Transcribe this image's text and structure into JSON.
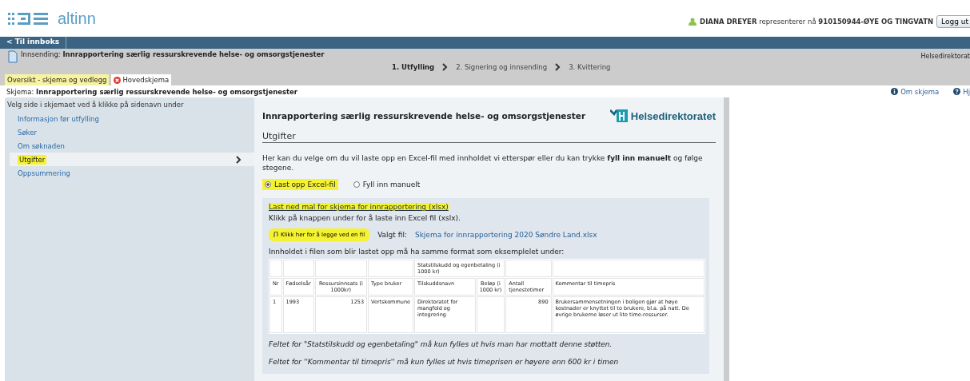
{
  "header": {
    "logo": "altinn",
    "user": "DIANA DREYER",
    "represents_label": "representerer nå",
    "org": "910150944-ØYE OG TINGVATN",
    "logout": "Logg ut"
  },
  "nav_bar": {
    "back": "< Til innboks"
  },
  "submission": {
    "label": "Innsending:",
    "title": "Innrapportering særlig ressurskrevende helse- og omsorgstjenester",
    "agency": "Helsedirektorat",
    "steps": [
      {
        "label": "1. Utfylling",
        "selected": true
      },
      {
        "label": "2. Signering og innsending",
        "selected": false
      },
      {
        "label": "3. Kvittering",
        "selected": false
      }
    ]
  },
  "tabs": [
    {
      "label": "Oversikt - skjema og vedlegg",
      "selected": false,
      "error": false
    },
    {
      "label": "Hovedskjema",
      "selected": true,
      "error": true
    }
  ],
  "form_line": {
    "label": "Skjema:",
    "title": "Innrapportering særlig ressurskrevende helse- og omsorgstjenester",
    "links": [
      "Om skjema",
      "Hj"
    ]
  },
  "sidebar": {
    "heading": "Velg side i skjemaet ved å klikke på sidenavn under",
    "items": [
      {
        "label": "Informasjon før utfylling",
        "selected": false,
        "highlighted": false
      },
      {
        "label": "Søker",
        "selected": false,
        "highlighted": false
      },
      {
        "label": "Om søknaden",
        "selected": false,
        "highlighted": false
      },
      {
        "label": "Utgifter",
        "selected": true,
        "highlighted": true
      },
      {
        "label": "Oppsummering",
        "selected": false,
        "highlighted": false
      }
    ]
  },
  "main": {
    "title": "Innrapportering særlig ressurskrevende helse- og omsorgstjenester",
    "brand": "Helsedirektoratet",
    "section": "Utgifter",
    "intro": "Her kan du velge om du vil laste opp en Excel-fil med innholdet vi etterspør eller du kan trykke **fyll inn manuelt** og følge stegene.",
    "options": [
      {
        "label": "Last opp Excel-fil",
        "selected": true,
        "highlighted": true
      },
      {
        "label": "Fyll inn manuelt",
        "selected": false,
        "highlighted": false
      }
    ],
    "download_link": {
      "label": "Last ned mal for skjema for innrapportering (xlsx)",
      "highlighted": true
    },
    "upload_hint": "Klikk på knappen under for å laste inn Excel fil (xslx).",
    "upload_button": {
      "label": "Klikk her for å legge ved en fil",
      "highlighted": true
    },
    "chosen_label": "Valgt fil:",
    "chosen_file": "Skjema for innrapportering 2020 Søndre Land.xlsx",
    "table_intro": "Innholdet i filen som blir lastet opp må ha samme format som eksemplelet under:",
    "table": {
      "group_header": "Statstilskudd og egenbetaling (i 1000 kr)",
      "columns": [
        "Nr",
        "Fødselsår",
        "Ressursinnsats (i 1000kr)",
        "Type bruker",
        "Tilskuddsnavn",
        "Beløp (i 1000 kr)",
        "Antall tjenestetimer",
        "Kommentar til timepris"
      ],
      "rows": [
        [
          "1",
          "1993",
          "1253",
          "Vertskommune",
          "Direktoratet for mangfold og integrering",
          "",
          "890",
          "Brukersammensetningen i boligen gjør at høye kostnader er knyttet til to brukere, bl.a. på natt. De øvrige brukerne løser ut lite time-ressurser."
        ]
      ]
    },
    "notes": [
      "Feltet for \"Statstilskudd og egenbetaling\" må kun fylles ut hvis man har mottatt denne støtten.",
      "Feltet for ''Kommentar til timepris'' må kun fylles ut hvis timeprisen er høyere enn 600 kr i timen"
    ]
  }
}
